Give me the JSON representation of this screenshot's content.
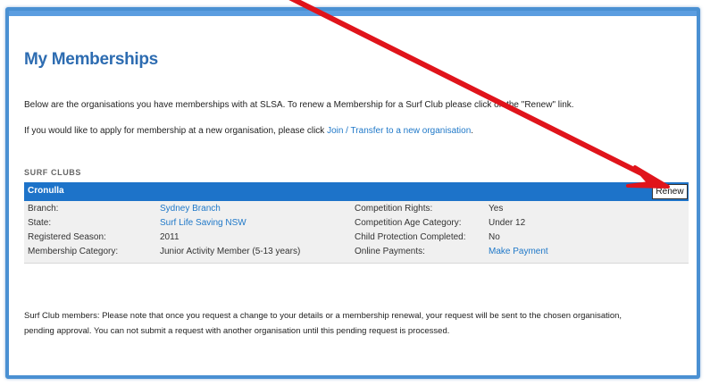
{
  "page": {
    "title": "My Memberships",
    "intro_text_1": "Below are the organisations you have memberships with at SLSA. To renew a Membership for a Surf Club please click on the \"Renew\" link.",
    "intro_text_2_prefix": "If you would like to apply for membership at a new organisation, please click ",
    "intro_text_2_link": "Join / Transfer to a new organisation",
    "intro_text_2_suffix": "."
  },
  "surf_clubs": {
    "section_label": "SURF CLUBS",
    "club": {
      "name": "Cronulla",
      "renew_label": "Renew",
      "rows": [
        {
          "label1": "Branch:",
          "value1": "Sydney Branch",
          "value1_link": true,
          "label2": "Competition Rights:",
          "value2": "Yes",
          "value2_link": false
        },
        {
          "label1": "State:",
          "value1": "Surf Life Saving NSW",
          "value1_link": true,
          "label2": "Competition Age Category:",
          "value2": "Under 12",
          "value2_link": false
        },
        {
          "label1": "Registered Season:",
          "value1": "2011",
          "value1_link": false,
          "label2": "Child Protection Completed:",
          "value2": "No",
          "value2_link": false
        },
        {
          "label1": "Membership Category:",
          "value1": "Junior Activity Member (5-13 years)",
          "value1_link": false,
          "label2": "Online Payments:",
          "value2": "Make Payment",
          "value2_link": true
        }
      ]
    }
  },
  "note": "Surf Club members: Please note that once you request a change to your details or a membership renewal, your request will be sent to the chosen organisation, pending approval. You can not submit a request with another organisation until this pending request is processed.",
  "colors": {
    "heading": "#2d6cb1",
    "link": "#1f78c8",
    "header_bar": "#1d73c9",
    "arrow": "#e0141b"
  },
  "icons": {
    "annotation_arrow": "red-arrow-icon"
  }
}
